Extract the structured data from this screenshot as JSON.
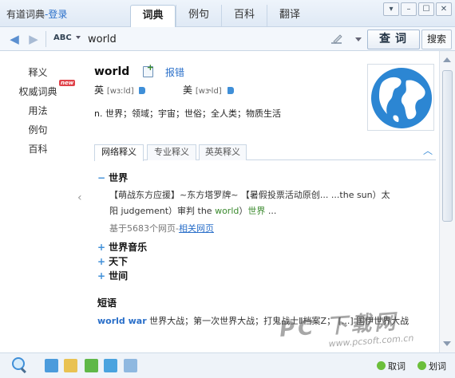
{
  "window": {
    "title": "有道词典",
    "login": "-登录",
    "tabs": [
      "词典",
      "例句",
      "百科",
      "翻译"
    ],
    "controls": [
      "▾",
      "–",
      "☐",
      "✕"
    ]
  },
  "search": {
    "lang_label": "ABC",
    "query": "world",
    "button_label": "查词",
    "secondary_button_label": "搜索"
  },
  "sidebar": {
    "items": [
      "释义",
      "权威词典",
      "用法",
      "例句",
      "百科"
    ],
    "badge": "new"
  },
  "entry": {
    "headword": "world",
    "report_label": "报错",
    "uk_label": "英",
    "uk_ipa": "[wɜːld]",
    "us_label": "美",
    "us_ipa": "[wɝld]",
    "definition": "n. 世界；领域；宇宙；世俗；全人类；物质生活"
  },
  "subtabs": [
    "网络释义",
    "专业释义",
    "英英释义"
  ],
  "web": {
    "sections": [
      {
        "sign": "−",
        "title": "世界"
      },
      {
        "sign": "+",
        "title": "世界音乐"
      },
      {
        "sign": "+",
        "title": "天下"
      },
      {
        "sign": "+",
        "title": "世间"
      }
    ],
    "definition_line1": "【萌战东方应援】~东方塔罗牌~ 【暑假投票活动原创... ...the sun）太",
    "definition_line2_pre": "阳 judgement）审判 the ",
    "definition_line2_hl1": "world",
    "definition_line2_mid": "）",
    "definition_line2_hl2": "世界",
    "definition_line2_post": " ...",
    "basis_text": "基于5683个网页-",
    "basis_link": "相关网页"
  },
  "phrases": {
    "heading": "短语",
    "en": "world war",
    "text": "世界大战；第一次世界大战；打鬼战士Ⅱ档案Z； [...] 国伊世界大战"
  },
  "bottom": {
    "cancel_label": "取词",
    "select_label": "划词"
  },
  "watermark": {
    "big": "PC 下载网",
    "url": "www.pcsoft.com.cn"
  },
  "colors": {
    "accent": "#2a6fc9",
    "highlight": "#3b8a2e",
    "badge": "#e0424a"
  }
}
